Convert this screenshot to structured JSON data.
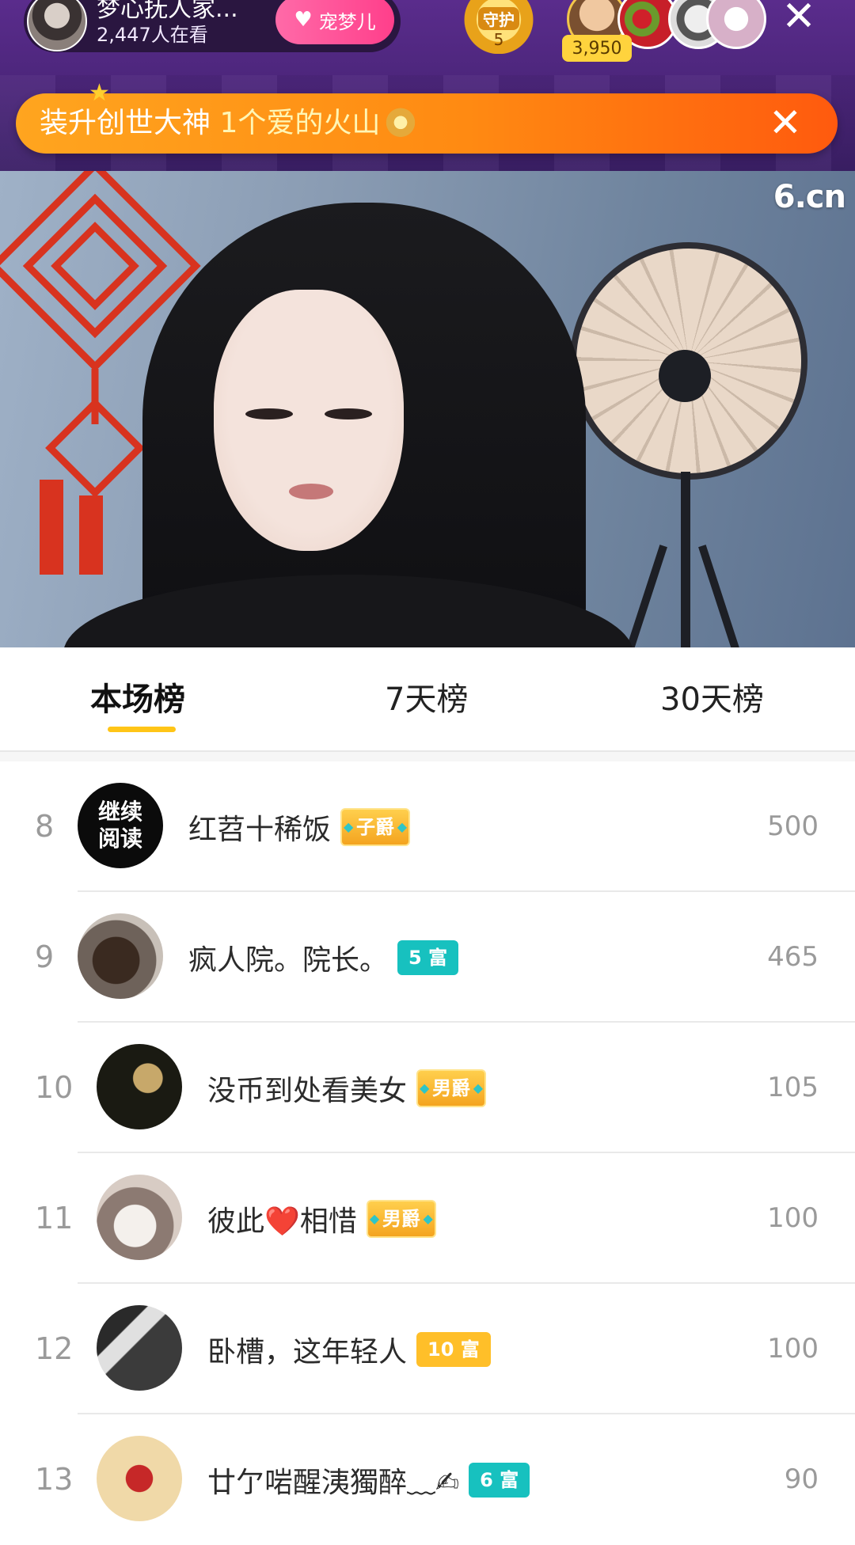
{
  "live_header": {
    "host_name": "梦心抚人家...",
    "viewers": "2,447人在看",
    "follow_label": "宠梦儿",
    "guard_label": "守护",
    "guard_count": "5",
    "fan_coins": "3,950",
    "close_icon": "close-icon"
  },
  "notice": {
    "prefix": "装升创世大神",
    "highlight": "1个爱的火山",
    "close_icon": "close-icon"
  },
  "video": {
    "watermark": "6.cn"
  },
  "tabs": [
    {
      "label": "本场榜",
      "active": true
    },
    {
      "label": "7天榜",
      "active": false
    },
    {
      "label": "30天榜",
      "active": false
    }
  ],
  "ranking": [
    {
      "rank": "8",
      "avatar_text": "继续\n阅读",
      "name": "红苕十稀饭",
      "badge": "子爵",
      "badge_type": "noble",
      "score": "500"
    },
    {
      "rank": "9",
      "name": "疯人院。院长。",
      "badge": "5 富",
      "badge_type": "rich-teal",
      "score": "465"
    },
    {
      "rank": "10",
      "name": "没币到处看美女",
      "badge": "男爵",
      "badge_type": "noble",
      "score": "105"
    },
    {
      "rank": "11",
      "name": "彼此❤️相惜",
      "badge": "男爵",
      "badge_type": "noble",
      "score": "100"
    },
    {
      "rank": "12",
      "name": "卧槽，这年轻人",
      "badge": "10 富",
      "badge_type": "rich-gold",
      "score": "100"
    },
    {
      "rank": "13",
      "name": "廿亇啱醒洟獨醉﹏✍",
      "badge": "6 富",
      "badge_type": "rich-teal",
      "score": "90"
    }
  ],
  "colors": {
    "header_purple": "#4a2579",
    "notice_orange": "#ff8a12",
    "tab_underline": "#ffc517",
    "rich_teal": "#17c1bf",
    "rich_gold": "#ffbf29"
  }
}
